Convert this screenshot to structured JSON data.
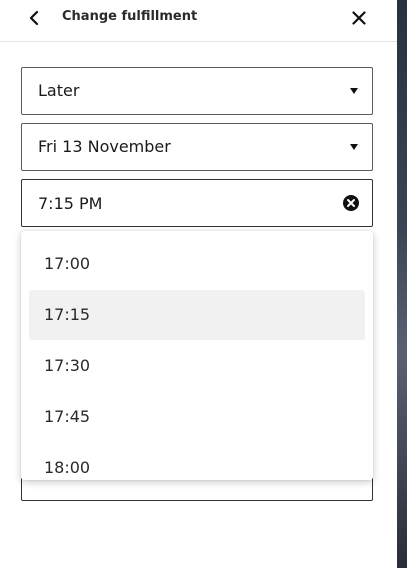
{
  "header": {
    "title": "Change fulfillment"
  },
  "form": {
    "when_value": "Later",
    "date_value": "Fri 13 November",
    "time_value": "7:15 PM"
  },
  "time_options": [
    "17:00",
    "17:15",
    "17:30",
    "17:45",
    "18:00"
  ],
  "highlighted_option": "17:15",
  "icons": {
    "back": "chevron-left-icon",
    "close": "close-icon",
    "caret": "caret-down-icon",
    "clear": "clear-circle-icon"
  },
  "colors": {
    "text": "#1a1a1a",
    "border": "#5c5c5c",
    "highlight": "#f1f1f1",
    "backdrop": "#3b4456"
  }
}
